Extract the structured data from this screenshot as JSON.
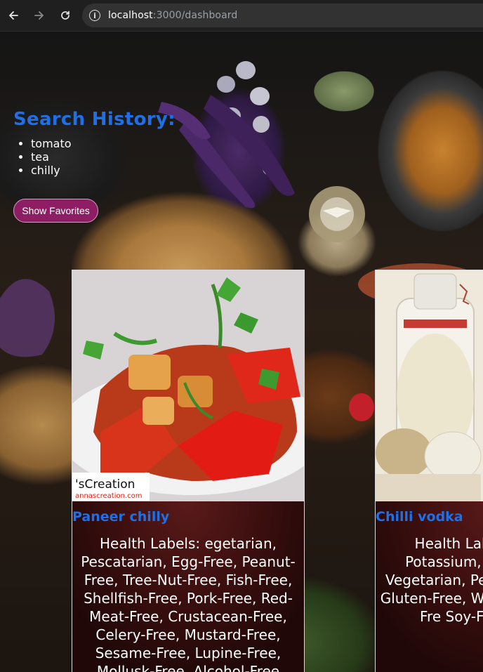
{
  "browser": {
    "url_host": "localhost",
    "url_path": ":3000/dashboard",
    "icons": [
      "back-arrow-icon",
      "forward-arrow-icon",
      "reload-icon",
      "site-info-icon"
    ]
  },
  "search_history": {
    "title": "Search History:",
    "items": [
      "tomato",
      "tea",
      "chilly"
    ]
  },
  "favorites_button": "Show Favorites",
  "cards": [
    {
      "title": "Paneer chilly",
      "labels": "Health Labels: egetarian, Pescatarian, Egg-Free, Peanut-Free, Tree-Nut-Free, Fish-Free, Shellfish-Free, Pork-Free, Red-Meat-Free, Crustacean-Free, Celery-Free, Mustard-Free, Sesame-Free, Lupine-Free, Mollusk-Free, Alcohol-Free",
      "image_watermark": "'sCreation",
      "image_watermark_url": "annascreation.com"
    },
    {
      "title": "Chilli vodka",
      "labels": "Health Labels: Low Potassium, Keto-Frien Vegetarian, Pe Mediterrane Gluten-Free, W Free, Peanut-Fre Soy-Free, Fish"
    }
  ]
}
